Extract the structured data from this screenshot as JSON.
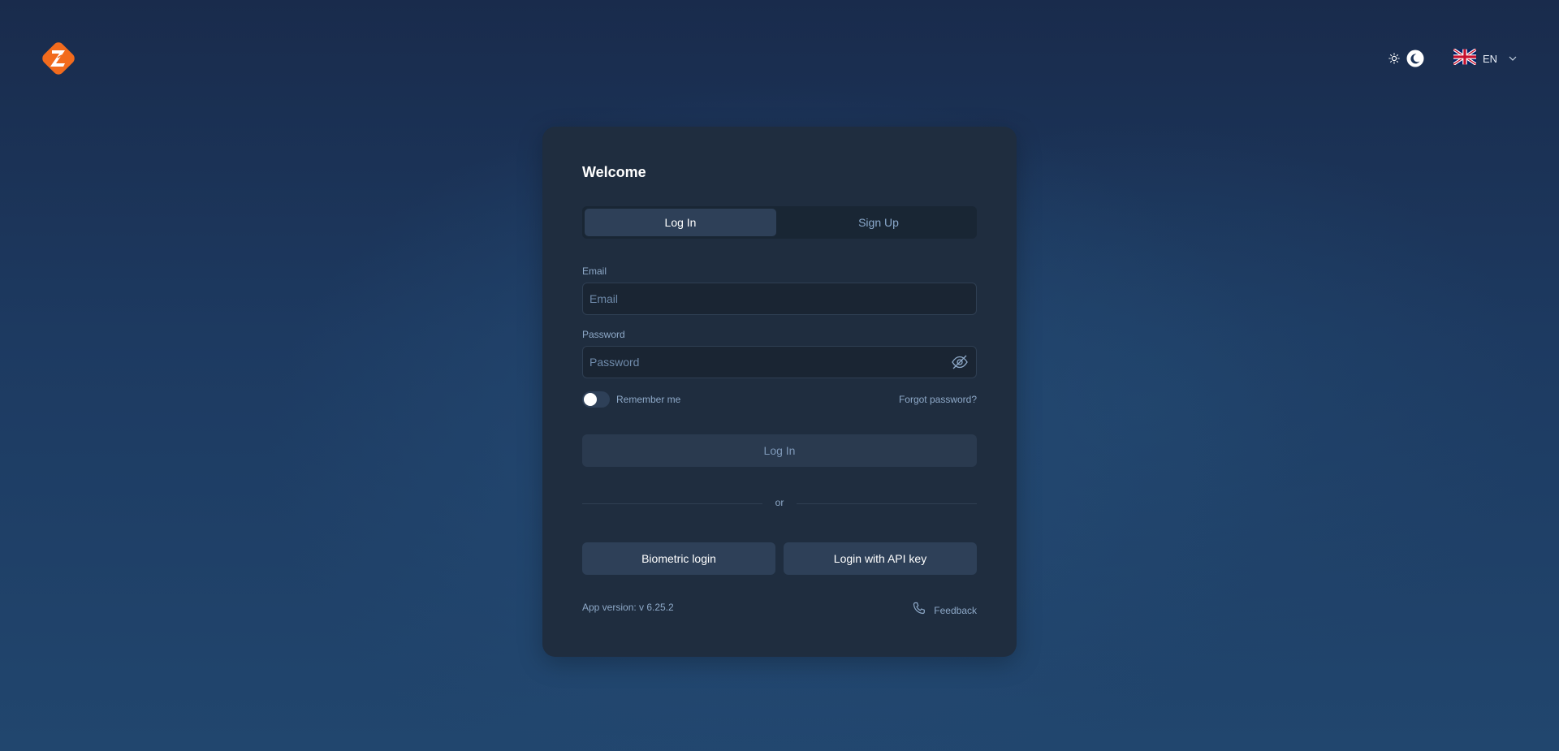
{
  "header": {
    "theme_icons": [
      "sun-icon",
      "moon-icon"
    ],
    "language": {
      "code": "EN",
      "flag_icon": "uk-flag-icon"
    }
  },
  "login_card": {
    "title": "Welcome",
    "tabs": [
      {
        "label": "Log In",
        "active": true
      },
      {
        "label": "Sign Up",
        "active": false
      }
    ],
    "email": {
      "label": "Email",
      "placeholder": "Email",
      "value": ""
    },
    "password": {
      "label": "Password",
      "placeholder": "Password",
      "value": ""
    },
    "remember_me": {
      "label": "Remember me",
      "checked": false
    },
    "forgot_password": "Forgot password?",
    "login_button": "Log In",
    "divider_text": "or",
    "biometric_button": "Biometric login",
    "api_key_button": "Login with API key",
    "app_version": "App version: v 6.25.2",
    "feedback": "Feedback"
  },
  "colors": {
    "brand_orange": "#f26b1d",
    "card_bg": "#1f2d3f",
    "muted_text": "#8ea9c8"
  }
}
